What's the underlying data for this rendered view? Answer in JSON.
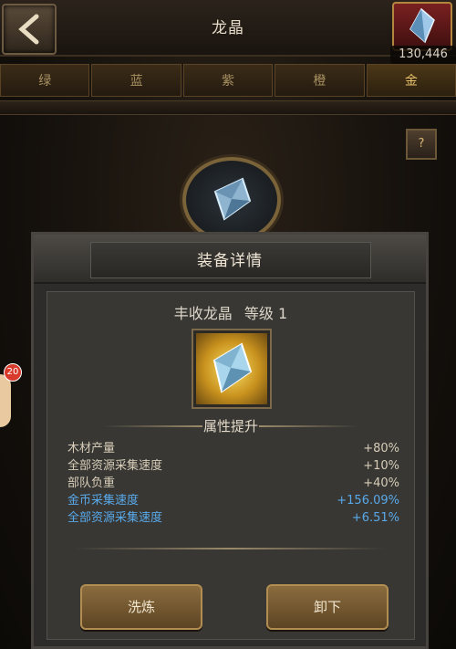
{
  "header": {
    "title": "龙晶",
    "resource_count": "130,446",
    "resource_icon": "crystal-icon"
  },
  "tabs": [
    {
      "label": "绿"
    },
    {
      "label": "蓝"
    },
    {
      "label": "紫"
    },
    {
      "label": "橙"
    },
    {
      "label": "金"
    }
  ],
  "help": {
    "label": "?"
  },
  "dialog": {
    "title": "装备详情",
    "item_name": "丰收龙晶",
    "item_level": "等级 1",
    "section_title": "属性提升",
    "attributes": [
      {
        "name": "木材产量",
        "value": "+80%"
      },
      {
        "name": "全部资源采集速度",
        "value": "+10%"
      },
      {
        "name": "部队负重",
        "value": "+40%"
      },
      {
        "name": "金币采集速度",
        "value": "+156.09%"
      },
      {
        "name": "全部资源采集速度",
        "value": "+6.51%"
      }
    ],
    "buttons": {
      "refine": "洗炼",
      "unequip": "卸下"
    }
  },
  "side": {
    "badge": "20"
  },
  "colors": {
    "gold": "#e7c16b",
    "blue_stat": "#59a9ea",
    "normal_stat": "#d7cdb8"
  }
}
